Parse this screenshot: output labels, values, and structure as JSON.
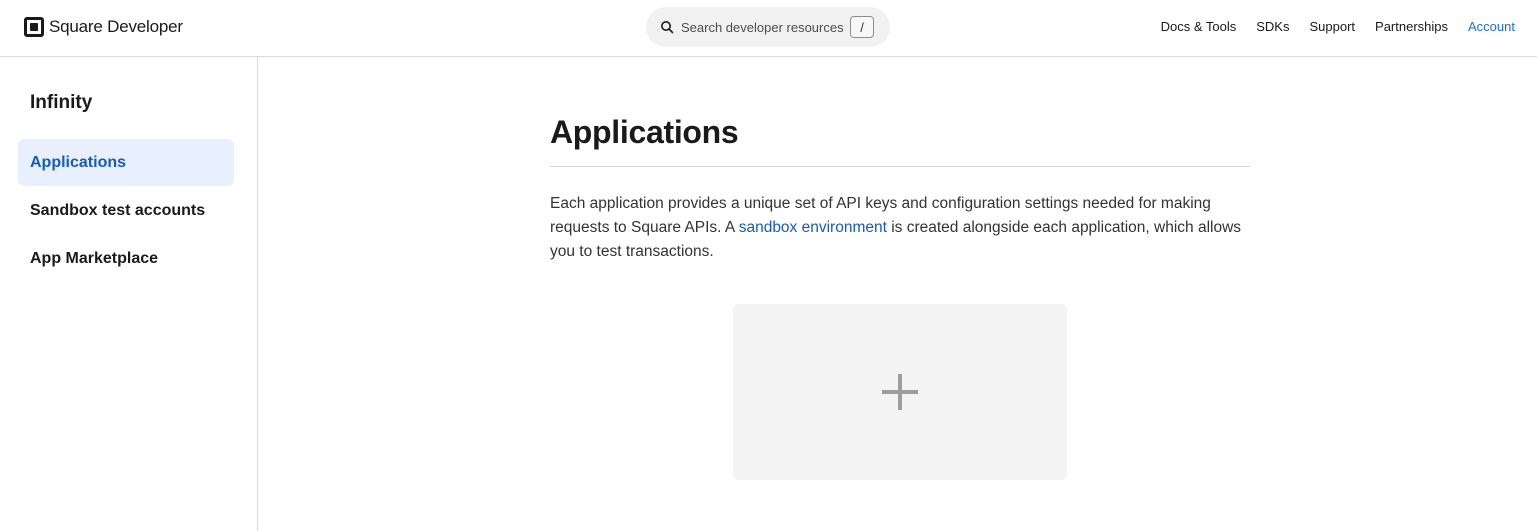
{
  "header": {
    "brand": "Square Developer",
    "search_placeholder": "Search developer resources",
    "search_shortcut": "/",
    "nav": [
      "Docs & Tools",
      "SDKs",
      "Support",
      "Partnerships",
      "Account"
    ],
    "accent_color": "#1a6fd6"
  },
  "sidebar": {
    "title": "Infinity",
    "items": [
      {
        "label": "Applications",
        "active": true
      },
      {
        "label": "Sandbox test accounts",
        "active": false
      },
      {
        "label": "App Marketplace",
        "active": false
      }
    ]
  },
  "main": {
    "title": "Applications",
    "description_part1": "Each application provides a unique set of API keys and configuration settings needed for making requests to Square APIs. A ",
    "description_link": "sandbox environment",
    "description_part2": " is created alongside each application, which allows you to test transactions.",
    "add_card_icon": "plus-icon"
  }
}
